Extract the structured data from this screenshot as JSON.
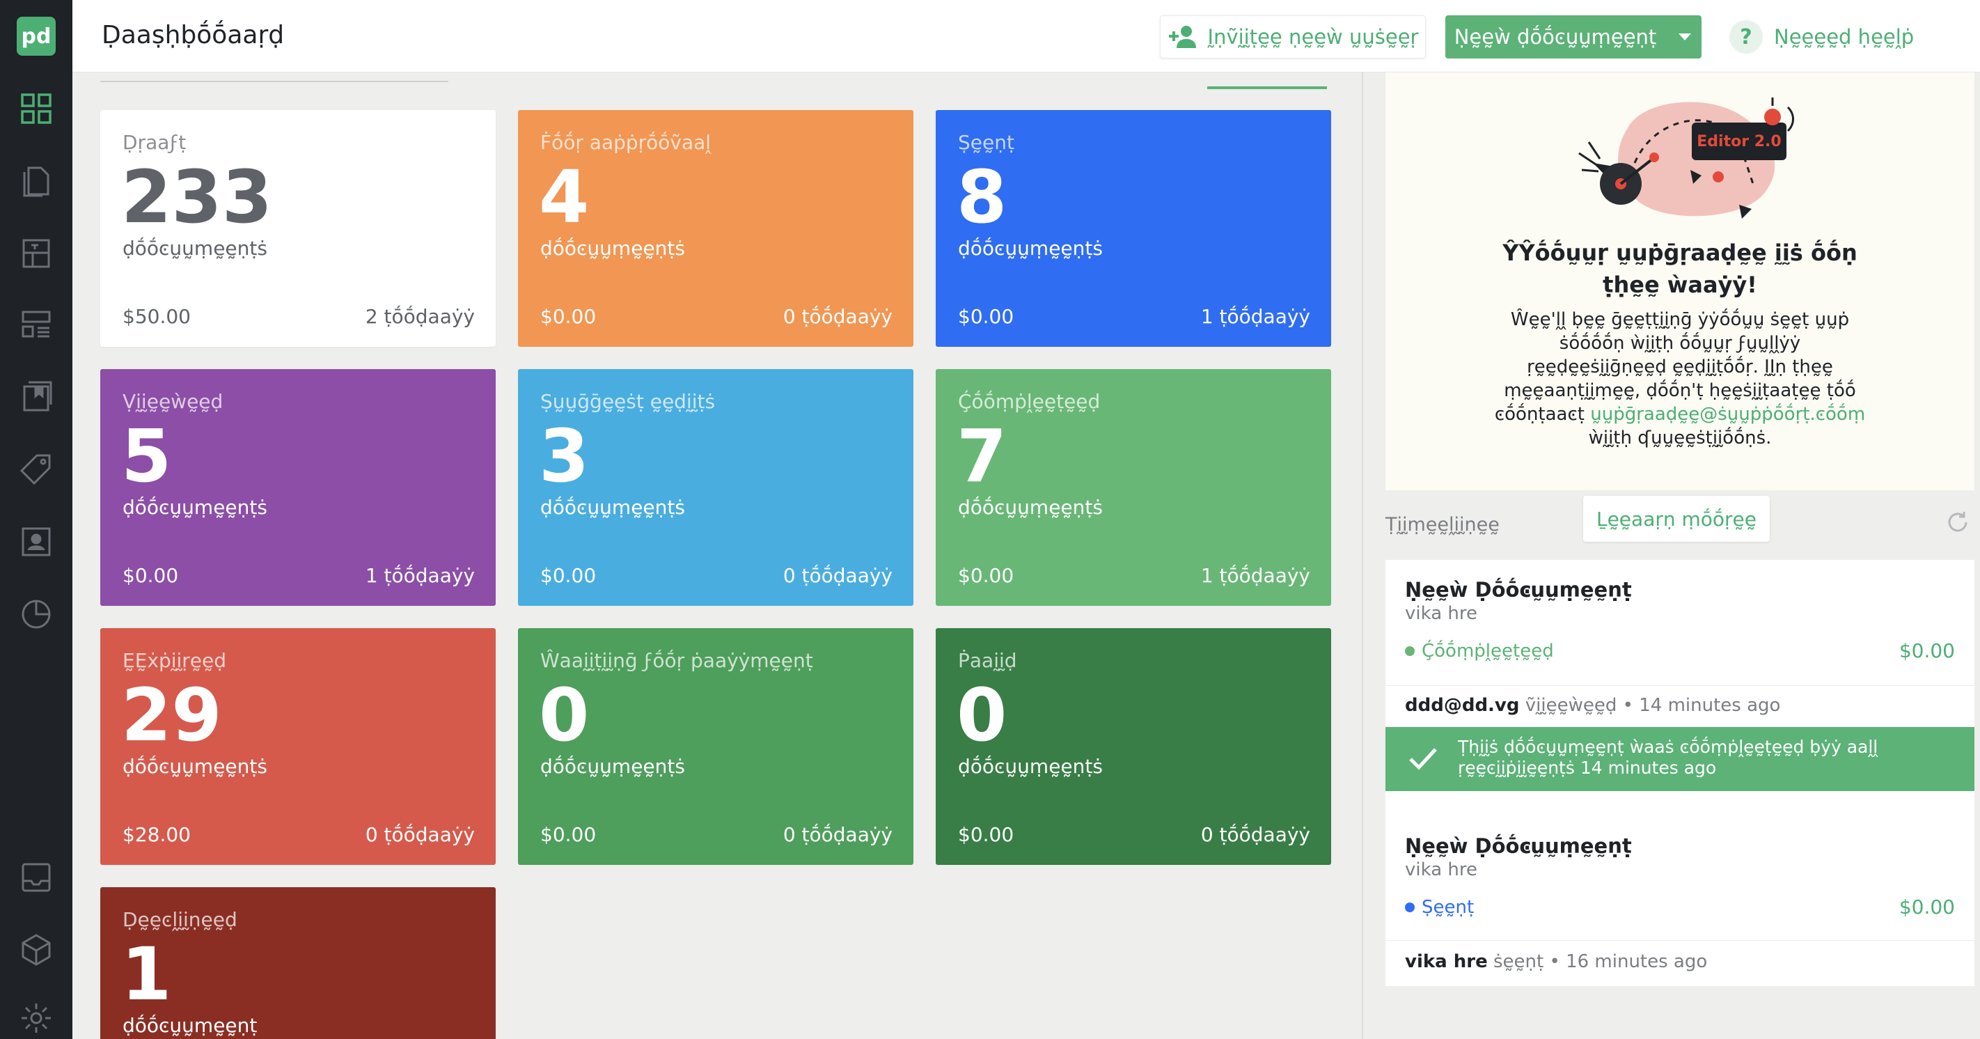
{
  "header": {
    "title": "Ḍaaṣḥḅṓṓaaṛḍ",
    "invite_label": "Ḭṇṽḭḭṭḛḛ ṇḛḛẁ ṵṵṡḛḛṛ",
    "new_document_label": "Ṇḛḛẁ ḍṓṓͼṵṵṃḛḛṇṭ",
    "help_label": "Ṇḛḛḛḛḍ ḥḛḛḽṗ",
    "help_glyph": "?"
  },
  "sidebar": {
    "logo": "pd",
    "items": [
      "dashboard-icon",
      "documents-icon",
      "templates-icon",
      "forms-icon",
      "catalog-icon",
      "tags-icon",
      "contacts-icon",
      "reports-icon",
      "inbox-icon",
      "integrations-icon",
      "settings-icon"
    ]
  },
  "cards": [
    {
      "title": "Ḍṛaaϝṭ",
      "count": "233",
      "unit": "ḍṓṓͼṵṵṃḛḛṇṭṡ",
      "amount": "$50.00",
      "today": "2 ṭṓṓḍaaẏẏ",
      "color": "#ffffff"
    },
    {
      "title": "Ḟṓṓṛ aaṗṗṛṓṓṽaaḽ",
      "count": "4",
      "unit": "ḍṓṓͼṵṵṃḛḛṇṭṡ",
      "amount": "$0.00",
      "today": "0 ṭṓṓḍaaẏẏ",
      "color": "#f19653"
    },
    {
      "title": "Ṣḛḛṇṭ",
      "count": "8",
      "unit": "ḍṓṓͼṵṵṃḛḛṇṭṡ",
      "amount": "$0.00",
      "today": "1 ṭṓṓḍaaẏẏ",
      "color": "#2f6df2"
    },
    {
      "title": "Ṿḭḭḛḛẁḛḛḍ",
      "count": "5",
      "unit": "ḍṓṓͼṵṵṃḛḛṇṭṡ",
      "amount": "$0.00",
      "today": "1 ṭṓṓḍaaẏẏ",
      "color": "#8c4ea7"
    },
    {
      "title": "Ṣṵṵḡḡḛḛṡṭ ḛḛḍḭḭṭṡ",
      "count": "3",
      "unit": "ḍṓṓͼṵṵṃḛḛṇṭṡ",
      "amount": "$0.00",
      "today": "0 ṭṓṓḍaaẏẏ",
      "color": "#4aade0"
    },
    {
      "title": "Ḉṓṓṃṗḽḛḛṭḛḛḍ",
      "count": "7",
      "unit": "ḍṓṓͼṵṵṃḛḛṇṭṡ",
      "amount": "$0.00",
      "today": "1 ṭṓṓḍaaẏẏ",
      "color": "#68b776"
    },
    {
      "title": "ḚḚẋṗḭḭṛḛḛḍ",
      "count": "29",
      "unit": "ḍṓṓͼṵṵṃḛḛṇṭṡ",
      "amount": "$28.00",
      "today": "0 ṭṓṓḍaaẏẏ",
      "color": "#d55a4c"
    },
    {
      "title": "Ŵaaḭḭṭḭḭṇḡ ϝṓṓṛ ṗaaẏẏṃḛḛṇṭ",
      "count": "0",
      "unit": "ḍṓṓͼṵṵṃḛḛṇṭṡ",
      "amount": "$0.00",
      "today": "0 ṭṓṓḍaaẏẏ",
      "color": "#4e9e5c"
    },
    {
      "title": "Ṗaaḭḭḍ",
      "count": "0",
      "unit": "ḍṓṓͼṵṵṃḛḛṇṭṡ",
      "amount": "$0.00",
      "today": "0 ṭṓṓḍaaẏẏ",
      "color": "#387e46"
    },
    {
      "title": "Ḍḛḛͼḽḭḭṇḛḛḍ",
      "count": "1",
      "unit": "ḍṓṓͼṵṵṃḛḛṇṭ",
      "amount": "",
      "today": "",
      "color": "#8a2e24"
    }
  ],
  "upgrade": {
    "badge": "Editor 2.0",
    "title_line1": "ŶŶṓṓṵṵṛ ṵṵṗḡṛaaḍḛḛ ḭḭṡ ṓṓṇ",
    "title_line2": "ṭḥḛḛ ẁaaẏẏ!",
    "body_before": "Ŵḛḛ'ḽḽ ḅḛḛ ḡḛḛṭṭḭḭṇḡ ẏẏṓṓṵṵ ṡḛḛṭ ṵṵṗ ṡṓṓṓṓṇ ẁḭḭṭḥ ṓṓṵṵṛ ϝṵṵḽḽẏẏ ṛḛḛḍḛḛṡḭḭḡṇḛḛḍ ḛḛḍḭḭṭṓṓṛ. ḬḬṇ ṭḥḛḛ ṃḛḛaaṇṭḭḭṃḛḛ, ḍṓṓṇ'ṭ ḥḛḛṡḭḭṭaaṭḛḛ ṭṓṓ ͼṓṓṇṭaaͼṭ",
    "email": "ṵṵṗḡṛaaḍḛḛ@ṡṵṵṗṗṓṓṛṭ.ͼṓṓṃ",
    "body_after": "ẁḭḭṭḥ ʠṵṵḛḛṡṭḭḭṓṓṇṡ.",
    "learn_more_label": "Ḻḛḛaaṛṇ ṃṓṓṛḛḛ"
  },
  "timeline": {
    "label": "Ṭḭḭṃḛḛḽḭḭṇḛḛ",
    "entries": [
      {
        "title": "Ṇḛḛẁ Ḍṓṓͼṵṵṃḛḛṇṭ",
        "owner": "vika hre",
        "status": "Ḉṓṓṃṗḽḛḛṭḛḛḍ",
        "status_color": "#68b776",
        "amount": "$0.00",
        "event_user": "ddd@dd.vg",
        "event_action": "ṽḭḭḛḛẁḛḛḍ",
        "event_time": "• 14 minutes ago",
        "banner_text": "Ṭḥḭḭṡ ḍṓṓͼṵṵṃḛḛṇṭ ẁaaṡ ͼṓṓṃṗḽḛḛṭḛḛḍ ḅẏẏ aaḽḽ ṛḛḛͼḭḭṗḭḭḛḛṇṭṡ",
        "banner_time": "14 minutes ago"
      },
      {
        "title": "Ṇḛḛẁ Ḍṓṓͼṵṵṃḛḛṇṭ",
        "owner": "vika hre",
        "status": "Ṣḛḛṇṭ",
        "status_color": "#2f6df2",
        "amount": "$0.00",
        "event_user": "vika hre",
        "event_action": "ṡḛḛṇṭ",
        "event_time": "• 16 minutes ago"
      }
    ]
  }
}
